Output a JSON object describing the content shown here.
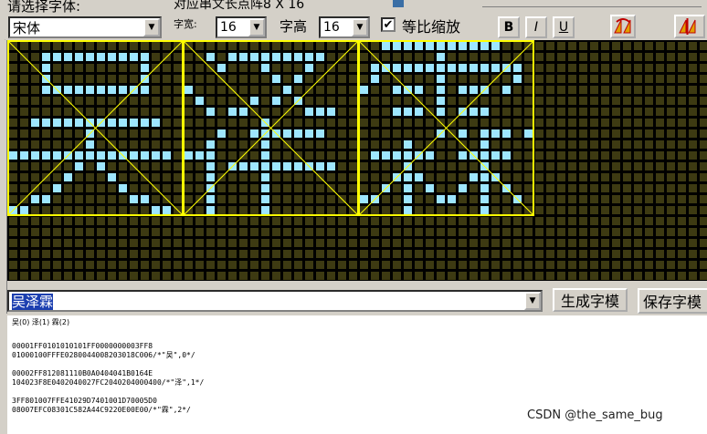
{
  "toolbar": {
    "select_font_label": "请选择字体:",
    "size_info_label": "对应串文长点阵8 X 16",
    "font_value": "宋体",
    "char_width_label": "字宽:",
    "char_width_value": "16",
    "char_height_label": "字高",
    "char_height_value": "16",
    "proportional_label": "等比缩放",
    "proportional_checked": true,
    "bold_label": "B",
    "italic_label": "I",
    "underline_label": "U",
    "left_edge_label": "比"
  },
  "input": {
    "text": "吴泽霖",
    "generate_label": "生成字模",
    "save_label": "保存字模"
  },
  "output": {
    "index_line": "吴(0) 泽(1) 霖(2)",
    "blocks": [
      [
        "00001FF0101010101FF0000000003FF8",
        "01000100FFFE0280044008203018C006/*\"吴\",0*/"
      ],
      [
        "00002FF812081110B0A0404041B0164E",
        "104023F8E0402040027FC2040204000400/*\"泽\",1*/"
      ],
      [
        "3FF801007FFE41029D7401001D70005D0",
        "08007EFC08301C582A44C9220E00E00/*\"霖\",2*/"
      ]
    ]
  },
  "watermark": "CSDN @the_same_bug",
  "colors": {
    "grid_bg": "#3d3a12",
    "grid_line": "#000000",
    "pixel_on": "#9ee6ff",
    "box": "#ffff00",
    "selection_bg": "#1c3fb0",
    "selection_fg": "#ffffff"
  },
  "glyphs": [
    [
      "0000000000000000",
      "0001111111111000",
      "0001000000001000",
      "0001000000001000",
      "0001111111111000",
      "0000000000000000",
      "0000000000000000",
      "0011111111111100",
      "0000000100000000",
      "0000000100000000",
      "1111111111111110",
      "0000001010000000",
      "0000010001000000",
      "0000100000100000",
      "0011000000011000",
      "1100000000000110"
    ],
    [
      "0000000000000000",
      "0010111111111000",
      "0001000100010000",
      "0000000010100000",
      "1000000001000000",
      "0100001010100000",
      "0010110000011100",
      "0000000100000000",
      "0001001111111000",
      "0010000100000000",
      "1110000100000000",
      "0010111111111100",
      "0010000100000000",
      "0010000100000000",
      "0010000100000000",
      "0010000100000000"
    ],
    [
      "0011111111111000",
      "0000000100000000",
      "0111111111111110",
      "0100000100000010",
      "1001110101110100",
      "0000000100000000",
      "0001110101110000",
      "0000000000000000",
      "0000000101011101",
      "0000100000010000",
      "0111111001111100",
      "0000100000010000",
      "0001110000111000",
      "0010101001010100",
      "1100100110010010",
      "0000100000010000"
    ]
  ]
}
